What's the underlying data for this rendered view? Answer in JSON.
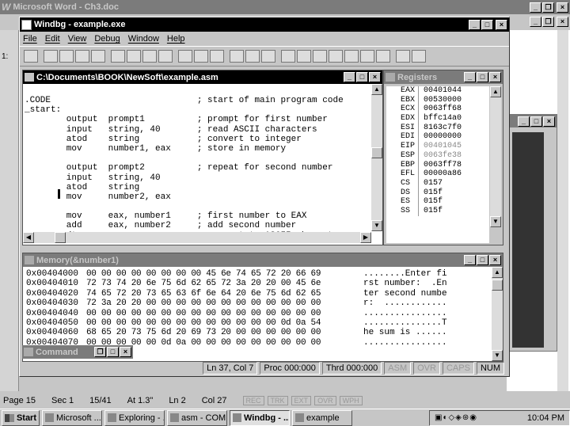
{
  "word": {
    "title": "Microsoft Word - Ch3.doc",
    "status": [
      {
        "k": "page",
        "v": "Page 15"
      },
      {
        "k": "sec",
        "v": "Sec 1"
      },
      {
        "k": "pages",
        "v": "15/41"
      },
      {
        "k": "at",
        "v": "At 1.3\""
      },
      {
        "k": "ln",
        "v": "Ln 2"
      },
      {
        "k": "col",
        "v": "Col 27"
      },
      {
        "k": "rec",
        "v": "REC"
      },
      {
        "k": "trk",
        "v": "TRK"
      },
      {
        "k": "ext",
        "v": "EXT"
      },
      {
        "k": "ovr",
        "v": "OVR"
      },
      {
        "k": "wph",
        "v": "WPH"
      }
    ],
    "side_label": "1:"
  },
  "windbg": {
    "title": "Windbg - example.exe",
    "menu": [
      "File",
      "Edit",
      "View",
      "Debug",
      "Window",
      "Help"
    ],
    "toolbar": [
      "open",
      "save",
      "cut",
      "copy",
      "paste",
      "step-into",
      "step-over",
      "run-to",
      "break",
      "restart",
      "go",
      "stop",
      "hand",
      "watch",
      "locals",
      "registers",
      "memory",
      "call-stack",
      "disasm",
      "cmd",
      "options",
      "hex",
      "source",
      "font"
    ],
    "status": [
      "Ln 37, Col 7",
      "Proc 000:000",
      "Thrd 000:000",
      "ASM",
      "OVR",
      "CAPS",
      "NUM"
    ]
  },
  "source": {
    "title": "C:\\Documents\\BOOK\\NewSoft\\example.asm",
    "lines": [
      ".CODE                            ; start of main program code",
      "_start:",
      "        output  prompt1          ; prompt for first number",
      "        input   string, 40       ; read ASCII characters",
      "        atod    string           ; convert to integer",
      "        mov     number1, eax     ; store in memory",
      "",
      "        output  prompt2          ; repeat for second number",
      "        input   string, 40",
      "        atod    string",
      "        mov     number2, eax",
      "",
      "        mov     eax, number1     ; first number to EAX",
      "        add     eax, number2     ; add second number",
      "        dtoa    sum, eax         ; convert to ASCII characters"
    ]
  },
  "registers": {
    "title": "Registers",
    "rows": [
      [
        "EAX",
        "00401044"
      ],
      [
        "EBX",
        "00530000"
      ],
      [
        "ECX",
        "0063ff68"
      ],
      [
        "EDX",
        "bffc14a0"
      ],
      [
        "ESI",
        "8163c7f0"
      ],
      [
        "EDI",
        "00000000"
      ],
      [
        "EIP",
        "00401045"
      ],
      [
        "ESP",
        "0063fe38"
      ],
      [
        "EBP",
        "0063ff78"
      ],
      [
        "EFL",
        "00000a86"
      ],
      [
        "CS",
        "0157"
      ],
      [
        "DS",
        "015f"
      ],
      [
        "ES",
        "015f"
      ],
      [
        "SS",
        "015f"
      ]
    ]
  },
  "memory": {
    "title": "Memory(&number1)",
    "rows": [
      [
        "0x00404000",
        "00 00 00 00 00 00 00 00 45 6e 74 65 72 20 66 69",
        "........Enter fi"
      ],
      [
        "0x00404010",
        "72 73 74 20 6e 75 6d 62 65 72 3a 20 20 00 45 6e",
        "rst number:  .En"
      ],
      [
        "0x00404020",
        "74 65 72 20 73 65 63 6f 6e 64 20 6e 75 6d 62 65",
        "ter second numbe"
      ],
      [
        "0x00404030",
        "72 3a 20 20 00 00 00 00 00 00 00 00 00 00 00 00",
        "r:  ............"
      ],
      [
        "0x00404040",
        "00 00 00 00 00 00 00 00 00 00 00 00 00 00 00 00",
        "................"
      ],
      [
        "0x00404050",
        "00 00 00 00 00 00 00 00 00 00 00 00 00 0d 0a 54",
        "...............T"
      ],
      [
        "0x00404060",
        "68 65 20 73 75 6d 20 69 73 20 00 00 00 00 00 00",
        "he sum is ......"
      ],
      [
        "0x00404070",
        "00 00 00 00 00 0d 0a 00 00 00 00 00 00 00 00 00",
        "................"
      ]
    ]
  },
  "command": {
    "title": "Command"
  },
  "taskbar": {
    "start": "Start",
    "tasks": [
      "Microsoft ...",
      "Exploring - ...",
      "asm - COM...",
      "Windbg - ...",
      "example"
    ],
    "clock": "10:04 PM"
  }
}
